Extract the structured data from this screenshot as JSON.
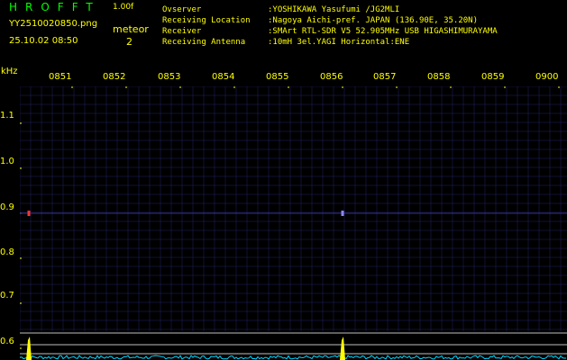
{
  "header": {
    "app_title": "HROFFT",
    "app_version": "1.00f",
    "file_name": "YY2510020850.png",
    "timestamp": "25.10.02 08:50",
    "meteor_label": "meteor",
    "meteor_count": "2"
  },
  "info": [
    {
      "key": "Ovserver",
      "value": ":YOSHIKAWA Yasufumi /JG2MLI"
    },
    {
      "key": "Receiving Location",
      "value": ":Nagoya Aichi-pref. JAPAN (136.90E, 35.20N)"
    },
    {
      "key": "Receiver",
      "value": ":SMArt RTL-SDR V5 52.905MHz USB HIGASHIMURAYAMA"
    },
    {
      "key": "Receiving Antenna",
      "value": ":10mH 3el.YAGI Horizontal:ENE"
    }
  ],
  "axis": {
    "y_unit": "kHz",
    "y_ticks": [
      "1.1",
      "1.0",
      "0.9",
      "0.8",
      "0.7",
      "0.6"
    ],
    "x_ticks": [
      "0851",
      "0852",
      "0853",
      "0854",
      "0855",
      "0856",
      "0857",
      "0858",
      "0859",
      "0900"
    ]
  },
  "colors": {
    "text": "#ffff00",
    "title": "#00ff00",
    "background": "#000000",
    "grid": "#1e1e5e",
    "echo": "#ff3333",
    "spectrum": "#00d8ff",
    "peak": "#ffff00",
    "reference": "#ffffff"
  },
  "spectrogram": {
    "carrier_khz": 0.9,
    "meteor_events_min": [
      0.0,
      5.8
    ]
  }
}
